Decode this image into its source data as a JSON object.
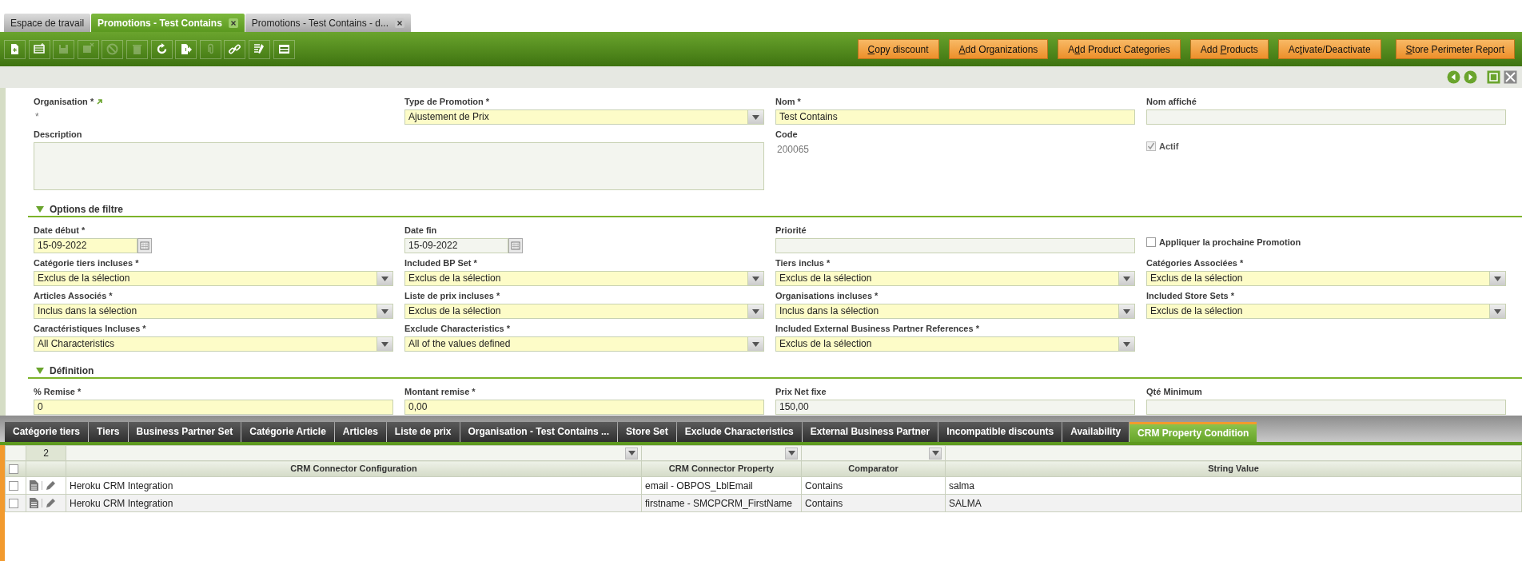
{
  "window_tabs": [
    {
      "label": "Espace de travail",
      "selected": false,
      "closable": false
    },
    {
      "label": "Promotions - Test Contains",
      "selected": true,
      "closable": true
    },
    {
      "label": "Promotions - Test Contains - d...",
      "selected": false,
      "closable": true
    }
  ],
  "toolbar": [
    {
      "kind": "new-document",
      "disabled": false
    },
    {
      "kind": "new-row",
      "disabled": false
    },
    {
      "kind": "save",
      "disabled": true
    },
    {
      "kind": "undo",
      "disabled": true
    },
    {
      "kind": "cancel",
      "disabled": true
    },
    {
      "kind": "delete",
      "disabled": true
    },
    {
      "kind": "refresh",
      "disabled": false
    },
    {
      "kind": "export",
      "disabled": false
    },
    {
      "kind": "attachment",
      "disabled": true
    },
    {
      "kind": "link",
      "disabled": false
    },
    {
      "kind": "tools",
      "disabled": false
    },
    {
      "kind": "toggle-view",
      "disabled": false
    }
  ],
  "action_buttons": [
    {
      "key": "C",
      "post": "opy discount"
    },
    {
      "key": "A",
      "post": "dd Organizations"
    },
    {
      "pre": "A",
      "key": "d",
      "post": "d Product Categories"
    },
    {
      "pre": "Add ",
      "key": "P",
      "post": "roducts"
    },
    {
      "pre": "Ac",
      "key": "t",
      "post": "ivate/Deactivate"
    },
    {
      "key": "S",
      "post": "tore Perimeter Report"
    }
  ],
  "form": {
    "fields": [
      {
        "kind": "display",
        "label": "Organisation *",
        "value": "*",
        "linked": true
      },
      {
        "kind": "select",
        "label": "Type de Promotion *",
        "value": "Ajustement de Prix",
        "required": true
      },
      {
        "kind": "text",
        "label": "Nom *",
        "value": "Test Contains",
        "required": true
      },
      {
        "kind": "text",
        "label": "Nom affiché",
        "required": false
      },
      {
        "kind": "textarea",
        "label": "Description",
        "required": false
      },
      {
        "kind": "display",
        "label": "Code",
        "value": "200065",
        "linked": false
      },
      {
        "kind": "checkbox",
        "label": "Actif",
        "checked": true,
        "disabled": true
      }
    ],
    "sections": [
      {
        "title": "Options de filtre",
        "expanded": true,
        "fields": [
          {
            "kind": "date",
            "label": "Date début *",
            "value": "15-09-2022",
            "required": true
          },
          {
            "kind": "date",
            "label": "Date fin",
            "value": "15-09-2022",
            "required": false
          },
          {
            "kind": "text",
            "label": "Priorité",
            "required": false
          },
          {
            "kind": "checkbox",
            "label": "Appliquer la prochaine Promotion",
            "checked": false,
            "disabled": false
          },
          {
            "kind": "select",
            "label": "Catégorie tiers incluses *",
            "value": "Exclus de la sélection",
            "required": true
          },
          {
            "kind": "select",
            "label": "Included BP Set *",
            "value": "Exclus de la sélection",
            "required": true
          },
          {
            "kind": "select",
            "label": "Tiers inclus *",
            "value": "Exclus de la sélection",
            "required": true
          },
          {
            "kind": "select",
            "label": "Catégories Associées *",
            "value": "Exclus de la sélection",
            "required": true
          },
          {
            "kind": "select",
            "label": "Articles Associés *",
            "value": "Inclus dans la sélection",
            "required": true
          },
          {
            "kind": "select",
            "label": "Liste de prix incluses *",
            "value": "Exclus de la sélection",
            "required": true
          },
          {
            "kind": "select",
            "label": "Organisations incluses *",
            "value": "Inclus dans la sélection",
            "required": true
          },
          {
            "kind": "select",
            "label": "Included Store Sets *",
            "value": "Exclus de la sélection",
            "required": true
          },
          {
            "kind": "select",
            "label": "Caractéristiques Incluses *",
            "value": "All Characteristics",
            "required": true
          },
          {
            "kind": "select",
            "label": "Exclude Characteristics *",
            "value": "All of the values defined",
            "required": true
          },
          {
            "kind": "select",
            "label": "Included External Business Partner References *",
            "value": "Exclus de la sélection",
            "required": true
          }
        ]
      },
      {
        "title": "Définition",
        "expanded": true,
        "fields": [
          {
            "kind": "text",
            "label": "% Remise *",
            "value": "0",
            "required": true
          },
          {
            "kind": "text",
            "label": "Montant remise *",
            "value": "0,00",
            "required": true
          },
          {
            "kind": "text",
            "label": "Prix Net fixe",
            "value": "150,00",
            "required": false
          },
          {
            "kind": "text",
            "label": "Qté Minimum",
            "required": false
          }
        ]
      }
    ]
  },
  "bottom_tabs": [
    {
      "label": "Catégorie tiers",
      "selected": false
    },
    {
      "label": "Tiers",
      "selected": false
    },
    {
      "label": "Business Partner Set",
      "selected": false
    },
    {
      "label": "Catégorie Article",
      "selected": false
    },
    {
      "label": "Articles",
      "selected": false
    },
    {
      "label": "Liste de prix",
      "selected": false
    },
    {
      "label": "Organisation - Test Contains ...",
      "selected": false
    },
    {
      "label": "Store Set",
      "selected": false
    },
    {
      "label": "Exclude Characteristics",
      "selected": false
    },
    {
      "label": "External Business Partner",
      "selected": false
    },
    {
      "label": "Incompatible discounts",
      "selected": false
    },
    {
      "label": "Availability",
      "selected": false
    },
    {
      "label": "CRM Property Condition",
      "selected": true
    }
  ],
  "grid": {
    "record_count": "2",
    "all_selected": false,
    "columns": [
      {
        "label": "CRM Connector Configuration",
        "filter_menu": true
      },
      {
        "label": "CRM Connector Property",
        "filter_menu": true
      },
      {
        "label": "Comparator",
        "filter_menu": true
      },
      {
        "label": "String Value",
        "filter_menu": false
      }
    ],
    "rows": [
      {
        "selected": false,
        "cells": [
          "Heroku CRM Integration",
          "email - OBPOS_LblEmail",
          "Contains",
          "salma"
        ]
      },
      {
        "selected": false,
        "cells": [
          "Heroku CRM Integration",
          "firstname - SMCPCRM_FirstName",
          "Contains",
          "SALMA"
        ]
      }
    ]
  }
}
